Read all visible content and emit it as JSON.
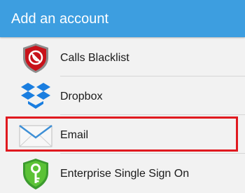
{
  "header": {
    "title": "Add an account",
    "background_color": "#3d9ee0"
  },
  "accounts": [
    {
      "label": "Calls Blacklist",
      "icon": "calls-blacklist-shield-icon"
    },
    {
      "label": "Dropbox",
      "icon": "dropbox-icon"
    },
    {
      "label": "Email",
      "icon": "email-envelope-icon",
      "highlighted": true
    },
    {
      "label": "Enterprise Single Sign On",
      "icon": "enterprise-sso-key-icon"
    }
  ],
  "highlight_color": "#e0191f"
}
